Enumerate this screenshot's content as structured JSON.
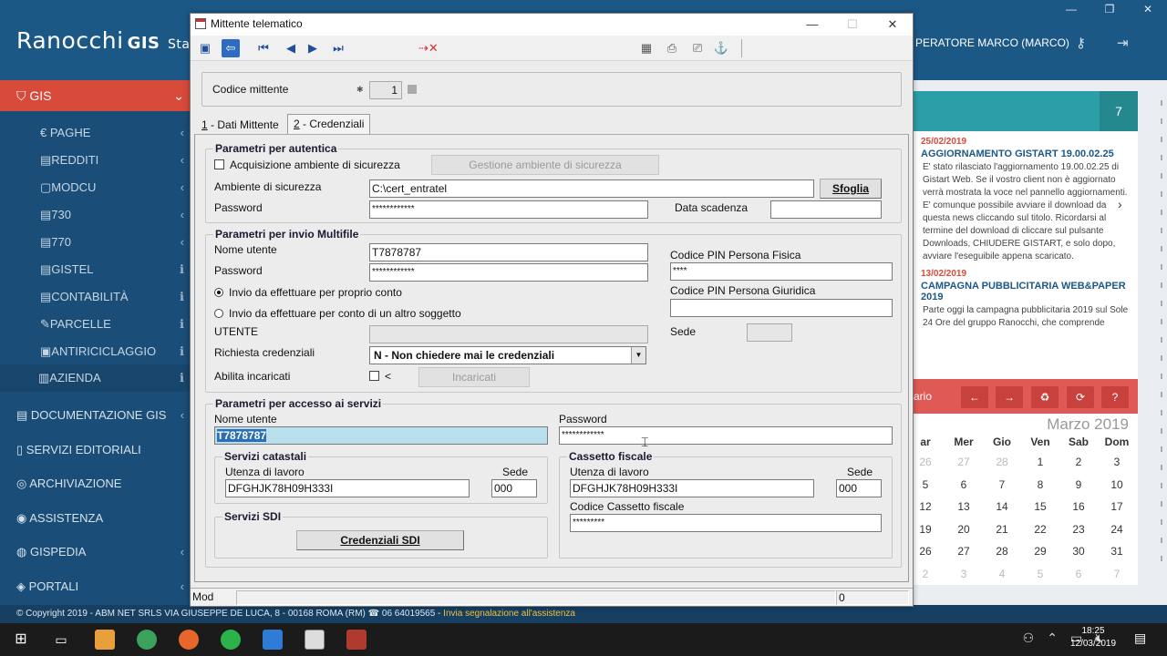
{
  "app": {
    "brand": "Ranocchi",
    "brand_suffix": "GIS",
    "brand_suffix2": "Sta",
    "operator": "PERATORE MARCO (MARCO)",
    "window_controls": [
      "—",
      "❐",
      "✕"
    ]
  },
  "sidebar": {
    "gis": {
      "label": "GIS",
      "chev": "⌄"
    },
    "sub_items": [
      {
        "label": "€ PAGHE",
        "r": "‹"
      },
      {
        "label": "▤REDDITI",
        "r": "‹"
      },
      {
        "label": "▢MODCU",
        "r": "‹"
      },
      {
        "label": "▤730",
        "r": "‹"
      },
      {
        "label": "▤770",
        "r": "‹"
      },
      {
        "label": "▤GISTEL",
        "r": "ℹ"
      },
      {
        "label": "▤CONTABILITÀ",
        "r": "ℹ"
      },
      {
        "label": "✎PARCELLE",
        "r": "ℹ"
      },
      {
        "label": "▣ANTIRICICLAGGIO",
        "r": "ℹ"
      },
      {
        "label": "▥AZIENDA",
        "r": "ℹ"
      }
    ],
    "main_items": [
      {
        "label": "DOCUMENTAZIONE GIS",
        "r": "‹"
      },
      {
        "label": "SERVIZI EDITORIALI",
        "r": ""
      },
      {
        "label": "ARCHIVIAZIONE",
        "r": ""
      },
      {
        "label": "ASSISTENZA",
        "r": ""
      },
      {
        "label": "GISPEDIA",
        "r": "‹"
      },
      {
        "label": "PORTALI",
        "r": "‹"
      }
    ]
  },
  "footer": {
    "text": "© Copyright 2019 - ABM NET SRLS VIA GIUSEPPE DE LUCA, 8 - 00168 ROMA (RM) ☎ 06 64019565 -",
    "link": "Invia segnalazione all'assistenza"
  },
  "news": {
    "count": "7",
    "items": [
      {
        "date": "25/02/2019",
        "title": "AGGIORNAMENTO GISTART 19.00.02.25",
        "body": "E' stato rilasciato l'aggiornamento 19.00.02.25 di Gistart Web. Se il vostro client non è aggiornato verrà mostrata la voce nel pannello aggiornamenti. E' comunque possibile avviare il download da questa news cliccando sul titolo. Ricordarsi al termine del download di cliccare sul pulsante Downloads, CHIUDERE GISTART, e solo dopo, avviare l'eseguibile appena scaricato."
      },
      {
        "date": "13/02/2019",
        "title": "CAMPAGNA PUBBLICITARIA WEB&PAPER 2019",
        "body": "Parte oggi la campagna pubblicitaria 2019 sul Sole 24 Ore del gruppo Ranocchi, che comprende anche le realtà collegate NTS Informatica (software gestionali per piccole"
      }
    ],
    "arrow": "›"
  },
  "calendar": {
    "label": "ario",
    "buttons": [
      "←",
      "→",
      "♻",
      "⟳",
      "?"
    ],
    "month": "Marzo 2019",
    "day_names": [
      "ar",
      "Mer",
      "Gio",
      "Ven",
      "Sab",
      "Dom"
    ],
    "weeks": [
      [
        "26",
        "27",
        "28",
        "1",
        "2",
        "3"
      ],
      [
        "5",
        "6",
        "7",
        "8",
        "9",
        "10"
      ],
      [
        "12",
        "13",
        "14",
        "15",
        "16",
        "17"
      ],
      [
        "19",
        "20",
        "21",
        "22",
        "23",
        "24"
      ],
      [
        "26",
        "27",
        "28",
        "29",
        "30",
        "31"
      ],
      [
        "2",
        "3",
        "4",
        "5",
        "6",
        "7"
      ]
    ]
  },
  "dialog": {
    "title": "Mittente telematico",
    "controls": [
      "—",
      "☐",
      "✕"
    ],
    "codice_label": "Codice mittente",
    "codice_star": "✱",
    "codice_value": "1",
    "tabs": [
      {
        "num": "1",
        "label": " - Dati Mittente"
      },
      {
        "num": "2",
        "label": " - Credenziali"
      }
    ],
    "autentica": {
      "title": "Parametri per autentica",
      "acq_label": "Acquisizione ambiente di sicurezza",
      "gestione_btn": "Gestione ambiente di sicurezza",
      "ambiente_label": "Ambiente di sicurezza",
      "ambiente_value": "C:\\cert_entratel",
      "sfoglia_btn": "Sfoglia",
      "password_label": "Password",
      "password_value": "************",
      "scadenza_label": "Data scadenza"
    },
    "multifile": {
      "title": "Parametri per invio Multifile",
      "nome_label": "Nome utente",
      "nome_value": "T7878787",
      "password_label": "Password",
      "password_value": "************",
      "radio1": "Invio da effettuare per proprio conto",
      "radio2": "Invio da effettuare per conto di un altro soggetto",
      "utente_label": "UTENTE",
      "richiesta_label": "Richiesta credenziali",
      "richiesta_value": "N  - Non chiedere mai le credenziali",
      "abilita_label": "Abilita incaricati",
      "abilita_extra": "<",
      "incaricati_btn": "Incaricati",
      "pin_fisica_label": "Codice PIN Persona Fisica",
      "pin_fisica_value": "****",
      "pin_giuridica_label": "Codice PIN Persona Giuridica",
      "sede_label": "Sede"
    },
    "servizi": {
      "title": "Parametri per accesso ai servizi",
      "nome_label": "Nome utente",
      "nome_value": "T7878787",
      "password_label": "Password",
      "password_value": "************",
      "catastali": {
        "title": "Servizi catastali",
        "utenza_label": "Utenza di lavoro",
        "utenza_value": "DFGHJK78H09H333I",
        "sede_label": "Sede",
        "sede_value": "000"
      },
      "cassetto": {
        "title": "Cassetto fiscale",
        "utenza_label": "Utenza di lavoro",
        "utenza_value": "DFGHJK78H09H333I",
        "sede_label": "Sede",
        "sede_value": "000",
        "codice_label": "Codice Cassetto fiscale",
        "codice_value": "*********"
      },
      "sdi": {
        "title": "Servizi SDI",
        "btn": "Credenziali SDI"
      }
    },
    "status": {
      "mode": "Mod",
      "right": "0"
    }
  },
  "taskbar": {
    "time": "18:25",
    "date": "12/03/2019"
  },
  "colors": {
    "topbar": "#1c5886",
    "sidebar": "#1a4d77",
    "accent_red": "#d84a3a",
    "news_head": "#2b9fa8",
    "cal_head": "#e05a55"
  }
}
